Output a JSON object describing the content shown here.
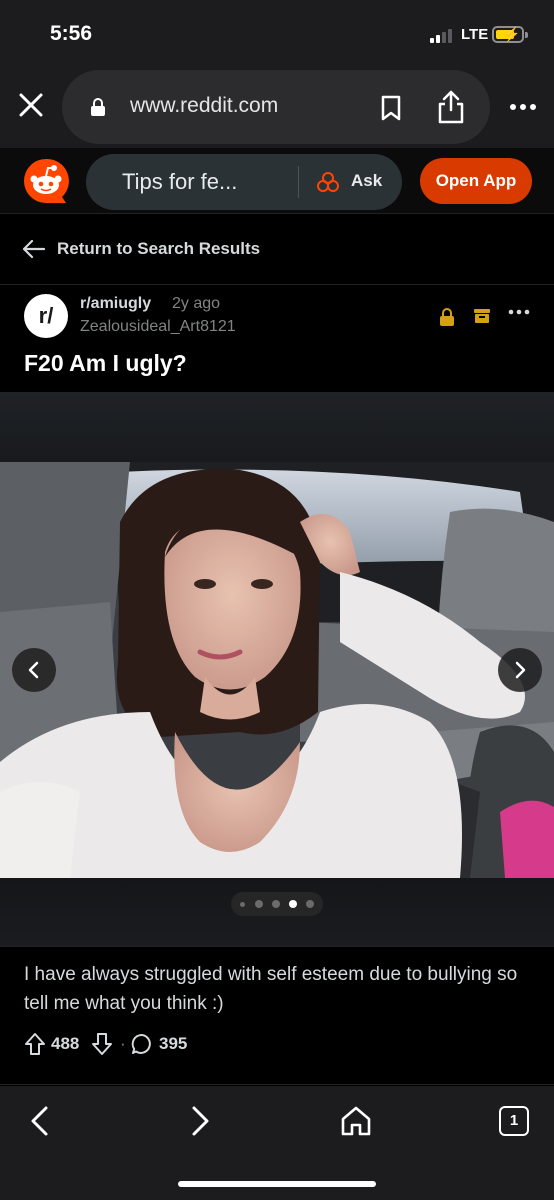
{
  "status": {
    "time": "5:56",
    "network": "LTE"
  },
  "browser": {
    "url": "www.reddit.com"
  },
  "header": {
    "search_text": "Tips for fe...",
    "ask_label": "Ask",
    "open_app_label": "Open App"
  },
  "nav": {
    "return_label": "Return to Search Results"
  },
  "post": {
    "avatar_text": "r/",
    "subreddit": "r/amiugly",
    "age": "2y ago",
    "author": "Zealousideal_Art8121",
    "title": "F20 Am I ugly?",
    "body": "I have always struggled with self esteem due to bullying so tell me what you think :)",
    "score": "488",
    "separator": "·",
    "comments": "395",
    "gallery": {
      "total_images": 5,
      "current_index": 4
    }
  },
  "bottom_bar": {
    "tab_count": "1"
  },
  "colors": {
    "accent": "#d93a00",
    "reddit_orange": "#ff4500",
    "badge_yellow": "#d4a017"
  }
}
